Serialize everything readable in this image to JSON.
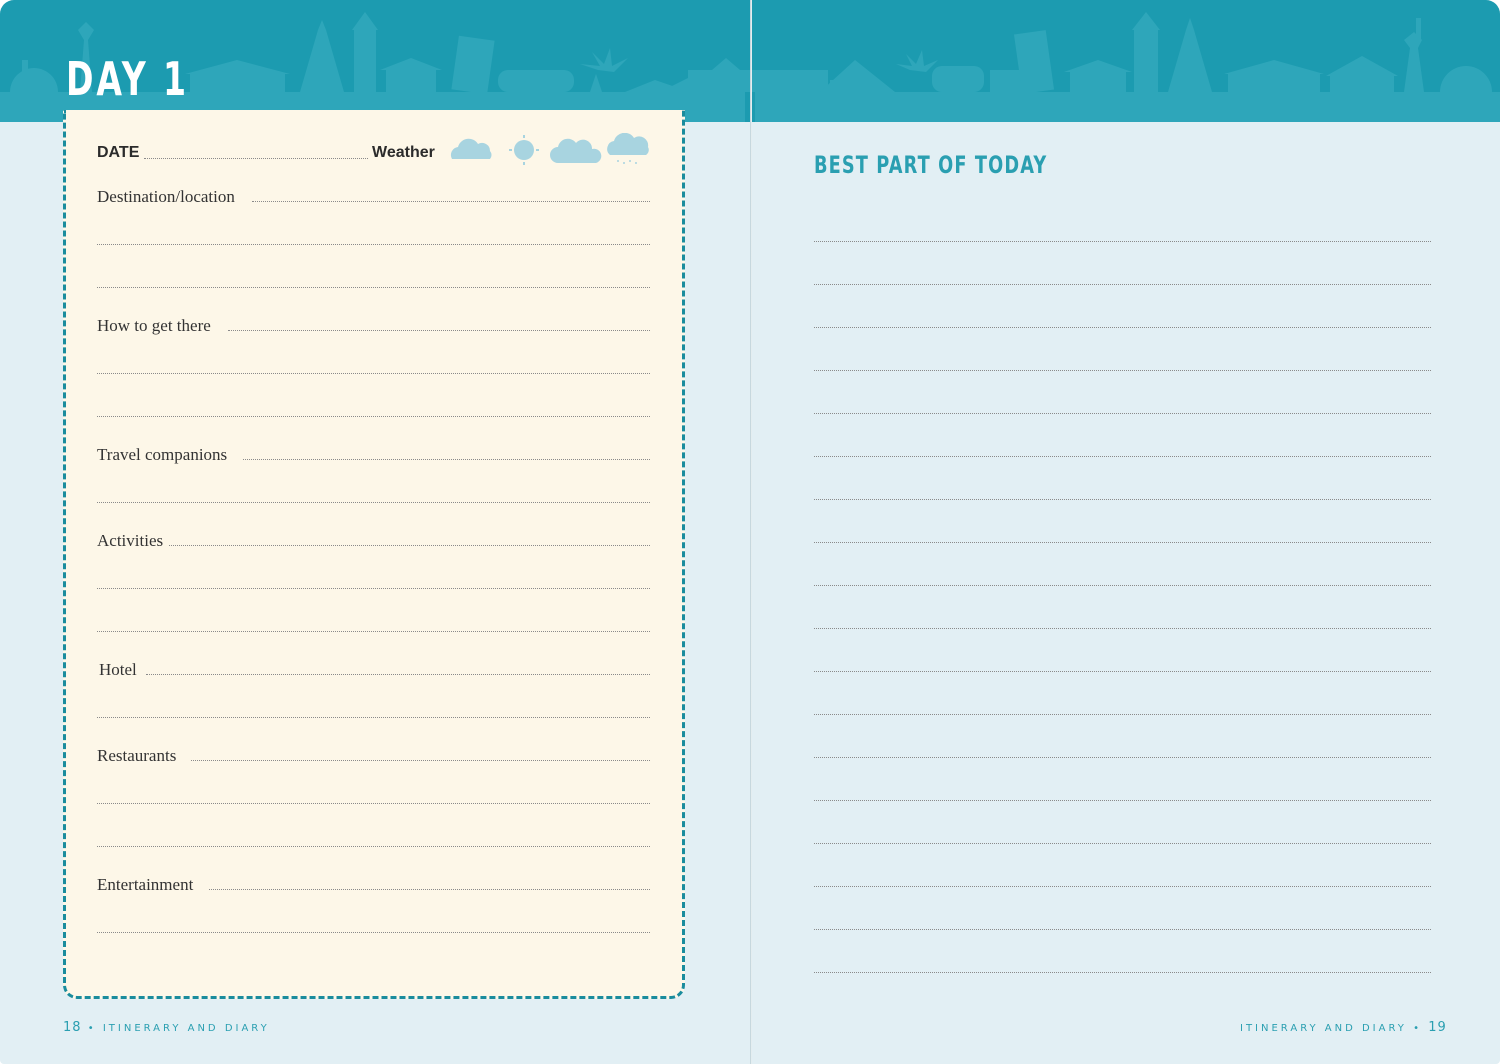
{
  "left_page": {
    "day_title": "DAY 1",
    "date_label": "DATE",
    "weather_label": "Weather",
    "weather_icons": [
      "cloud-icon",
      "sun-icon",
      "clouds-icon",
      "rain-cloud-icon"
    ],
    "fields": {
      "destination": "Destination/location",
      "how_to_get_there": "How to get there",
      "travel_companions": "Travel companions",
      "activities": "Activities",
      "hotel": "Hotel",
      "restaurants": "Restaurants",
      "entertainment": "Entertainment"
    },
    "folio_number": "18",
    "folio_separator": "•",
    "folio_text": "ITINERARY AND DIARY"
  },
  "right_page": {
    "title": "BEST PART OF TODAY",
    "folio_text": "ITINERARY AND DIARY",
    "folio_separator": "•",
    "folio_number": "19"
  },
  "colors": {
    "banner": "#1c9bb0",
    "page_background": "#e2eff4",
    "card_background": "#fdf7e8",
    "accent": "#2a9fb1",
    "dashed_border": "#1a8c9d"
  }
}
